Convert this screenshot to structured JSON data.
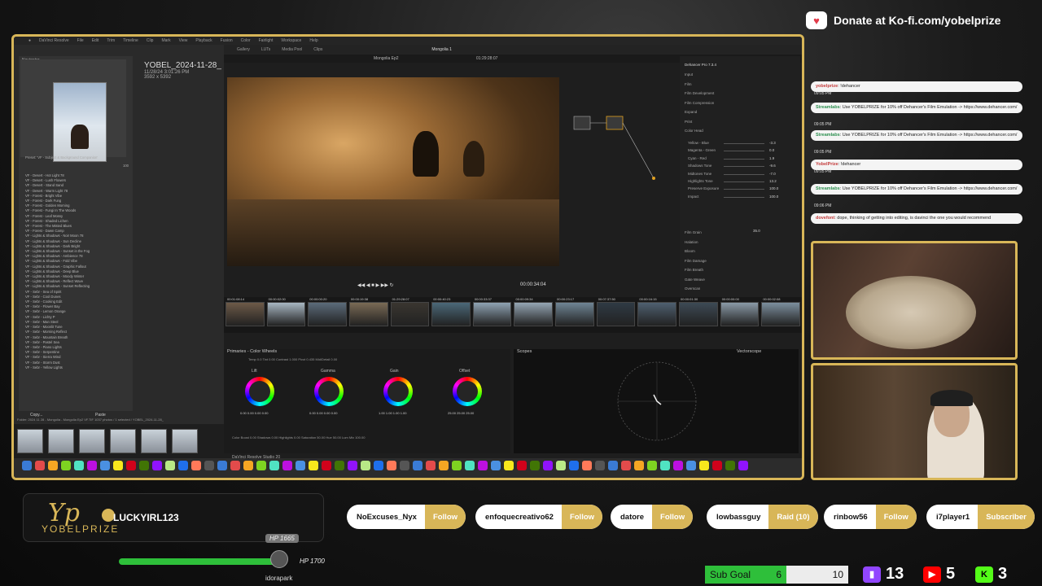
{
  "donate": {
    "text": "Donate at Ko-fi.com/yobelprize"
  },
  "resolve": {
    "window_title": "Mongolia 1",
    "clip_name": "Mongolia Ep2",
    "timecode": "01:29:28:07",
    "playhead": "00:00:34:04",
    "panel_primaries": "Primaries - Color Wheels",
    "panel_scopes": "Scopes",
    "panel_vectorscope": "Vectorscope",
    "app_label": "DaVinci Resolve Studio 20",
    "effects_title": "Dehancer Pro 7.3.4",
    "effects_items": [
      "Input",
      "Film",
      "Film Development",
      "Film Compression",
      "Expand",
      "Print",
      "Color Head",
      "Film Grain",
      "Halation",
      "Bloom",
      "Film Damage",
      "Film Breath",
      "Gate Weave",
      "Overscan"
    ],
    "color_head": [
      {
        "label": "Yellow - Blue",
        "value": "-3.3"
      },
      {
        "label": "Magenta - Green",
        "value": "0.0"
      },
      {
        "label": "Cyan - Red",
        "value": "1.9"
      },
      {
        "label": "Shadows Tone",
        "value": "-9.6"
      },
      {
        "label": "Midtones Tone",
        "value": "-7.0"
      },
      {
        "label": "Highlights Tone",
        "value": "13.2"
      },
      {
        "label": "Preserve Exposure",
        "value": "100.0"
      },
      {
        "label": "Impact",
        "value": "100.0"
      }
    ],
    "grain_value": "35.0",
    "wheels": [
      {
        "name": "Lift",
        "vals": "0.00 0.00 0.00 0.00"
      },
      {
        "name": "Gamma",
        "vals": "0.00 0.00 0.00 0.00"
      },
      {
        "name": "Gain",
        "vals": "1.00 1.00 1.00 1.00"
      },
      {
        "name": "Offset",
        "vals": "25.00 25.00 25.00"
      }
    ],
    "wheel_params_top": "Temp 0.0   Tint 0.00   Contrast 1.000   Pivot 0.435   Mid/Detail 0.00",
    "wheel_params_bottom": "Color Boost 0.00   Shadows 0.00   Highlights 0.00   Saturation 50.00   Hue 50.00   Lum Mix 100.00",
    "clip_timecodes": [
      "00:01:08:14",
      "00:00:02:00",
      "00:00:00:20",
      "00:00:19:38",
      "01:29:28:07",
      "00:00:40:23",
      "00:00:33:37",
      "00:00:09:34",
      "00:00:23:17",
      "00:07:37:50",
      "00:00:16:15",
      "00:00:01:30",
      "00:00:00:00",
      "00:00:02:08"
    ]
  },
  "lightroom": {
    "file_title": "YOBEL_2024-11-28_",
    "file_date": "11/28/24 3:01:26 PM",
    "file_size": "3592 x 5392",
    "panel_navigator": "Navigator",
    "preset_note": "Preset: 'VF - Subject & Background Companion'",
    "preset_count": "100",
    "presets": [
      "VF - Desert - Hot Light 78",
      "VF - Desert - Lush Flowers",
      "VF - Desert - Stand Sand",
      "VF - Desert - Warm Light 78",
      "VF - Forest - Bright Vibe",
      "VF - Forest - Dark Fung",
      "VF - Forest - Golden Morning",
      "VF - Forest - Fungi In The Woods",
      "VF - Forest - Leaf Mossy",
      "VF - Forest - Shaded Lichen",
      "VF - Forest - The Misted Blues",
      "VF - Forest - Dawn Camp",
      "VF - Lights & Shadows - Noir Moon 78",
      "VF - Lights & Shadows - Sun Decline",
      "VF - Lights & Shadows - Dark Bright",
      "VF - Lights & Shadows - Sunset in the Fog",
      "VF - Lights & Shadows - Ambience 78",
      "VF - Lights & Shadows - Fold Vibe",
      "VF - Lights & Shadows - Graphic Fallout",
      "VF - Lights & Shadows - Deep Blue",
      "VF - Lights & Shadows - Moody Winter",
      "VF - Lights & Shadows - Reflect Wave",
      "VF - Lights & Shadows - Sunset Reflecting",
      "VF - Sebr - Sea of Spirit",
      "VF - Sebr - Cool Dunes",
      "VF - Sebr - Cooking Edit",
      "VF - Sebr - Flower Bay",
      "VF - Sebr - Lemon Orange",
      "VF - Sebr - Lichty P",
      "VF - Sebr - Man Steel",
      "VF - Sebr - Moonlit Tune",
      "VF - Sebr - Morning Reflect",
      "VF - Sebr - Mountain Breath",
      "VF - Sebr - Pastel Sea",
      "VF - Sebr - Piano Lights",
      "VF - Sebr - Serpentine",
      "VF - Sebr - Sierra Wind",
      "VF - Sebr - Storm Dust",
      "VF - Sebr - Yellow Lights"
    ],
    "filmstrip_info": "Folder: 2024 11 28 - Mongolia - Mongolia Ep2 VF.TIF   1037 photos / 1 selected / YOBEL_2024-11-28_",
    "copy_btn": "Copy...",
    "paste_btn": "Paste"
  },
  "chat": {
    "messages": [
      {
        "user": "yobelprize",
        "text": ": !dehancer",
        "ts": "09:05 PM"
      },
      {
        "user": "Streamlabs",
        "text": ": Use YOBELPRIZE for 10% off Dehancer's Film Emulation -> https://www.dehancer.com/",
        "ts": "09:05 PM"
      },
      {
        "user": "Streamlabs",
        "text": ": Use YOBELPRIZE for 10% off Dehancer's Film Emulation -> https://www.dehancer.com/",
        "ts": "09:05 PM"
      },
      {
        "user": "YobelPrize",
        "text": ": !dehancer",
        "ts": "09:05 PM"
      },
      {
        "user": "Streamlabs",
        "text": ": Use YOBELPRIZE for 10% off Dehancer's Film Emulation -> https://www.dehancer.com/",
        "ts": "09:06 PM"
      },
      {
        "user": "dovefont",
        "text": ": dope, thinking of getting into editing, is davinci the one you would recommend",
        "ts": ""
      }
    ]
  },
  "bottom": {
    "brand": "YOBELPRIZE",
    "brand_mark": "Yp",
    "streamer": "LUCKYIRL123",
    "hp_low": "HP 1665",
    "hp_high": "HP 1700",
    "viewer": "idorapark",
    "alerts": [
      {
        "name": "NoExcuses_Nyx",
        "action": "Follow"
      },
      {
        "name": "enfoquecreativo62",
        "action": "Follow"
      },
      {
        "name": "datore",
        "action": "Follow"
      },
      {
        "name": "lowbassguy",
        "action": "Raid (10)"
      },
      {
        "name": "rinbow56",
        "action": "Follow"
      },
      {
        "name": "i7player1",
        "action": "Subscriber"
      }
    ],
    "goal_label": "Sub Goal",
    "goal_current": "6",
    "goal_target": "10",
    "twitch_count": "13",
    "youtube_count": "5",
    "kick_count": "3"
  },
  "colors": {
    "accent": "#d8b658",
    "hp": "#2ebf3a",
    "twitch": "#9146ff",
    "youtube": "#ff0000",
    "kick": "#53fc18"
  }
}
